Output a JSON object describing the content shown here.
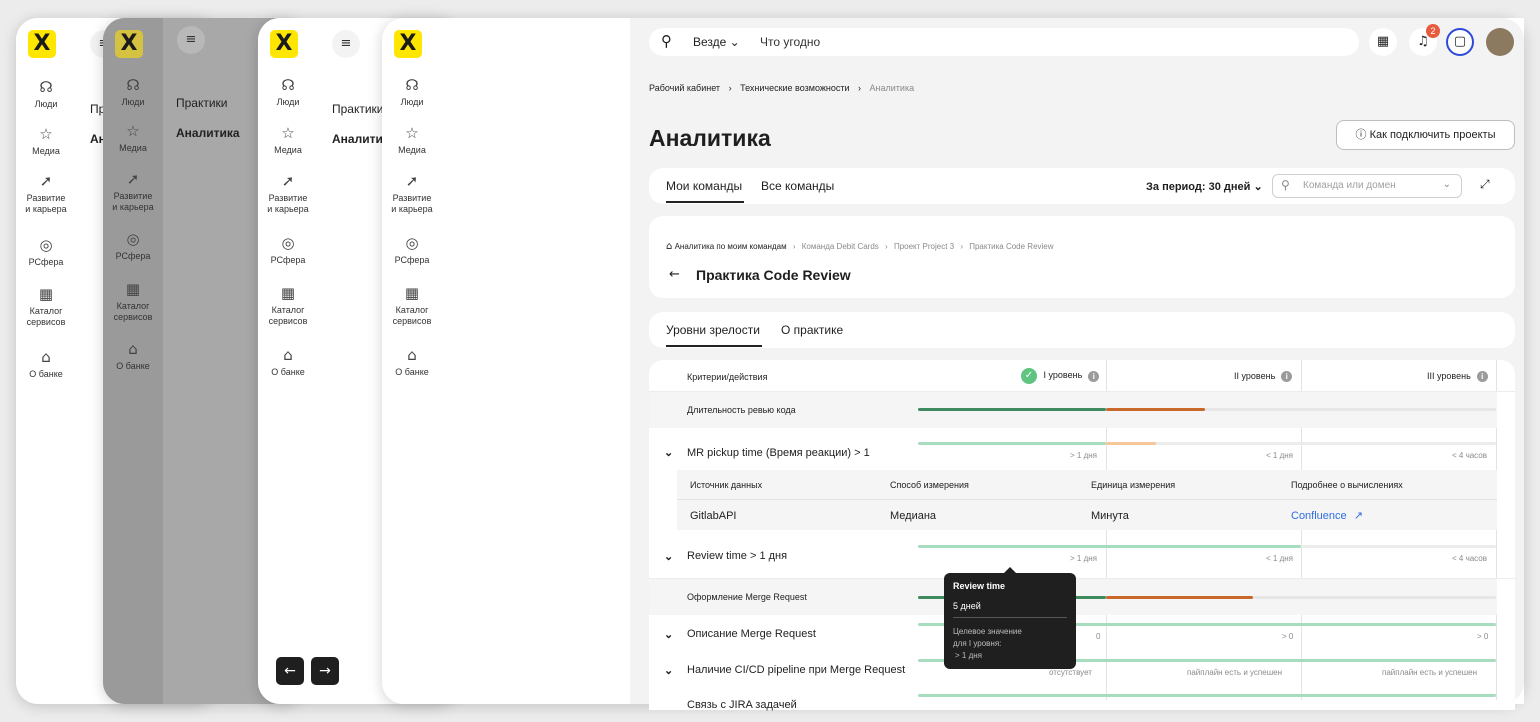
{
  "rail": {
    "items": [
      {
        "label": "Люди",
        "label2": "",
        "icon": "people-icon"
      },
      {
        "label": "Медиа",
        "label2": "",
        "icon": "star-icon"
      },
      {
        "label": "Развитие",
        "label2": "и карьера",
        "icon": "rocket-icon"
      },
      {
        "label": "РСфера",
        "label2": "",
        "icon": "sphere-icon"
      },
      {
        "label": "Каталог",
        "label2": "сервисов",
        "icon": "grid-icon"
      },
      {
        "label": "О банке",
        "label2": "",
        "icon": "bank-icon"
      }
    ],
    "logo": "X"
  },
  "submenu": {
    "items": [
      "Практики",
      "Аналитика"
    ],
    "partial": [
      "Пр",
      "Ан"
    ]
  },
  "search": {
    "scope": "Везде",
    "placeholder": "Что угодно"
  },
  "notifications": {
    "count": "2"
  },
  "breadcrumb": [
    "Рабочий кабинет",
    "Технические возможности",
    "Аналитика"
  ],
  "page": {
    "title": "Аналитика",
    "connect_button": "Как подключить проекты"
  },
  "team_tabs": {
    "tabs": [
      "Мои команды",
      "Все команды"
    ],
    "active": 0,
    "period": "За период: 30 дней",
    "filter_placeholder": "Команда или домен"
  },
  "practice": {
    "crumb": [
      "Аналитика по моим командам",
      "Команда Debit Cards",
      "Проект Project 3",
      "Практика Code Review"
    ],
    "title": "Практика Code Review"
  },
  "maturity_tabs": {
    "tabs": [
      "Уровни зрелости",
      "О практике"
    ],
    "active": 0
  },
  "table": {
    "header": {
      "criteria": "Критерии/действия",
      "levels": [
        "I уровень",
        "II уровень",
        "III уровень"
      ]
    },
    "group1": "Длительность ревью кода",
    "row_mr_pickup": {
      "label": "MR pickup time (Время реакции) > 1",
      "thresholds": [
        "> 1 дня",
        "< 1 дня",
        "< 4 часов"
      ]
    },
    "details": {
      "headers": [
        "Источник данных",
        "Способ измерения",
        "Единица измерения",
        "Подробнее о вычислениях"
      ],
      "values": [
        "GitlabAPI",
        "Медиана",
        "Минута",
        "Confluence"
      ]
    },
    "row_review": {
      "label": "Review time > 1 дня",
      "thresholds": [
        "> 1 дня",
        "< 1 дня",
        "< 4 часов"
      ]
    },
    "group2": "Оформление Merge Request",
    "row_desc": {
      "label": "Описание Merge Request",
      "thresholds": [
        "0",
        "> 0",
        "> 0"
      ]
    },
    "row_cicd": {
      "label": "Наличие CI/CD pipeline при Merge Request",
      "thresholds": [
        "отсутствует",
        "пайплайн есть и успешен",
        "пайплайн есть и успешен"
      ]
    },
    "row_jira": {
      "label": "Связь с JIRA задачей"
    }
  },
  "tooltip": {
    "title": "Review time",
    "value": "5 дней",
    "note1": "Целевое значение",
    "note2": "для I уровня:",
    "note3": "> 1 дня"
  },
  "colors": {
    "accent": "#fee600",
    "dark_green": "#3f8a5f",
    "orange": "#c8692b",
    "light_green": "#a8dcbf",
    "light_orange": "#f5c79a",
    "link": "#2f6ee0",
    "badge": "#e85a3d"
  }
}
